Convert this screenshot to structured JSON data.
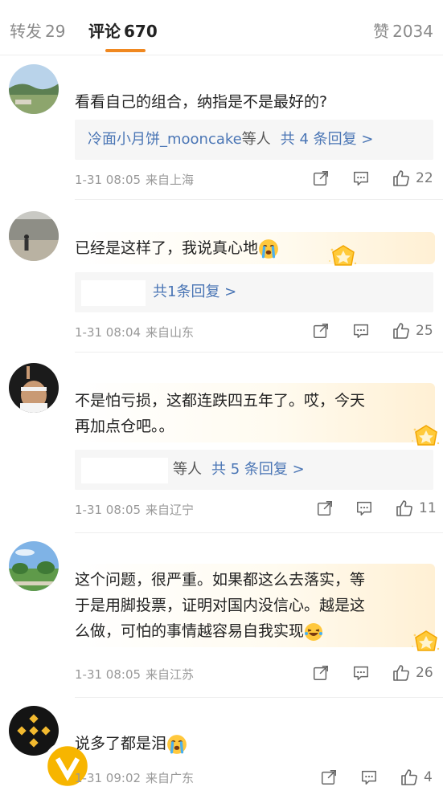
{
  "tabs": {
    "repost": {
      "label": "转发",
      "count": "29"
    },
    "comments": {
      "label": "评论",
      "count": "670"
    },
    "likes": {
      "label": "赞",
      "count": "2034"
    }
  },
  "comments": [
    {
      "text": "看看自己的组合，纳指是不是最好的?",
      "reply_user": "冷面小月饼_mooncake",
      "reply_suffix": "等人",
      "reply_link": "共 4 条回复 >",
      "time": "1-31 08:05",
      "location": "来自上海",
      "likes": "22"
    },
    {
      "text": "已经是这样了，我说真心地",
      "emoji": "crying-emoji",
      "reply_link": "共1条回复 >",
      "time": "1-31 08:04",
      "location": "来自山东",
      "likes": "25"
    },
    {
      "line1": "不是怕亏损，这都连跌四五年了。哎，今天",
      "line2": "再加点仓吧。。",
      "reply_suffix": "等人",
      "reply_link": "共 5 条回复 >",
      "time": "1-31 08:05",
      "location": "来自辽宁",
      "likes": "11"
    },
    {
      "line1": "这个问题，很严重。如果都这么去落实，等",
      "line2": "于是用脚投票，证明对国内没信心。越是这",
      "line3": "么做，可怕的事情越容易自我实现",
      "emoji": "laugh-cry-emoji",
      "time": "1-31 08:05",
      "location": "来自江苏",
      "likes": "26"
    },
    {
      "text": "说多了都是泪",
      "emoji": "crying-emoji",
      "time": "1-31 09:02",
      "location": "来自广东",
      "likes": "4"
    }
  ],
  "colors": {
    "accent": "#f08820",
    "link": "#4b76b5",
    "meta": "#999999"
  }
}
